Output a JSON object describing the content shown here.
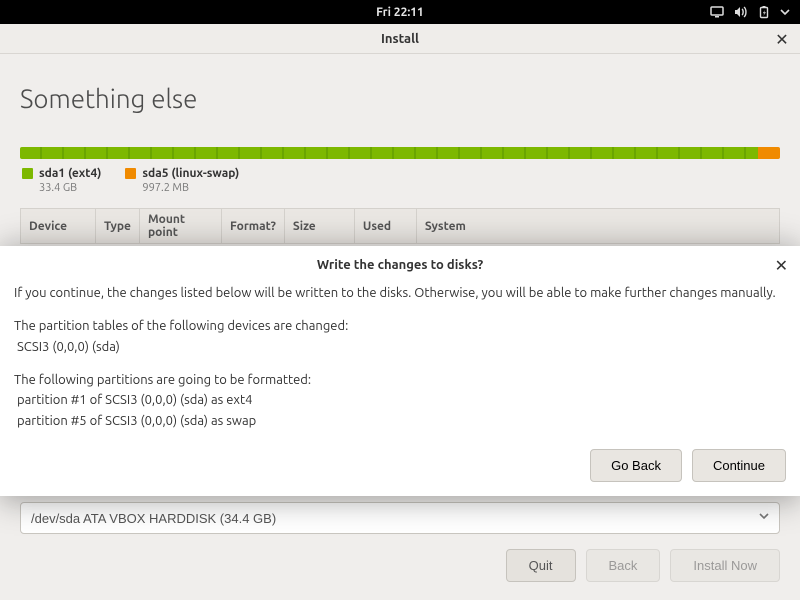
{
  "topbar": {
    "clock": "Fri 22:11"
  },
  "window": {
    "title": "Install"
  },
  "page": {
    "heading": "Something else"
  },
  "disk_strip": {
    "legend": [
      {
        "label": "sda1 (ext4)",
        "size": "33.4 GB",
        "color": "#7db800"
      },
      {
        "label": "sda5 (linux-swap)",
        "size": "997.2 MB",
        "color": "#f08a00"
      }
    ]
  },
  "columns": {
    "device": "Device",
    "type": "Type",
    "mount": "Mount point",
    "format": "Format?",
    "size": "Size",
    "used": "Used",
    "system": "System"
  },
  "bootloader": {
    "value": "/dev/sda   ATA VBOX HARDDISK (34.4 GB)"
  },
  "footer": {
    "quit": "Quit",
    "back": "Back",
    "install": "Install Now"
  },
  "dialog": {
    "title": "Write the changes to disks?",
    "p1": "If you continue, the changes listed below will be written to the disks. Otherwise, you will be able to make further changes manually.",
    "p2": "The partition tables of the following devices are changed:",
    "p2a": " SCSI3 (0,0,0) (sda)",
    "p3": "The following partitions are going to be formatted:",
    "p3a": " partition #1 of SCSI3 (0,0,0) (sda) as ext4",
    "p3b": " partition #5 of SCSI3 (0,0,0) (sda) as swap",
    "go_back": "Go Back",
    "continue": "Continue"
  }
}
